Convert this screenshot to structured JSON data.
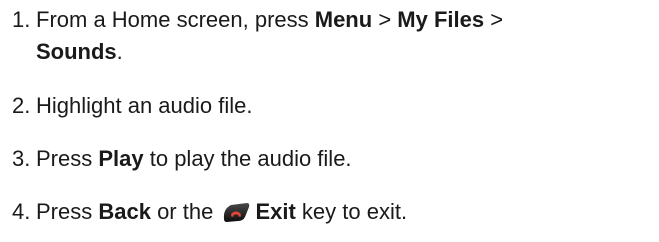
{
  "steps": [
    {
      "number": "1.",
      "parts": [
        "From a Home screen, press ",
        "Menu",
        " > ",
        "My Files",
        " >"
      ],
      "continuation_bold": "Sounds",
      "continuation_tail": "."
    },
    {
      "number": "2.",
      "text": "Highlight an audio file."
    },
    {
      "number": "3.",
      "pre": "Press ",
      "bold": "Play",
      "post": " to play the audio file."
    },
    {
      "number": "4.",
      "pre": "Press ",
      "bold1": "Back",
      "mid": " or the ",
      "icon": "end-call-key-icon",
      "bold2": "Exit",
      "post": " key to exit."
    }
  ],
  "colors": {
    "text": "#1a1a1a",
    "icon_fill": "#e0473a"
  }
}
